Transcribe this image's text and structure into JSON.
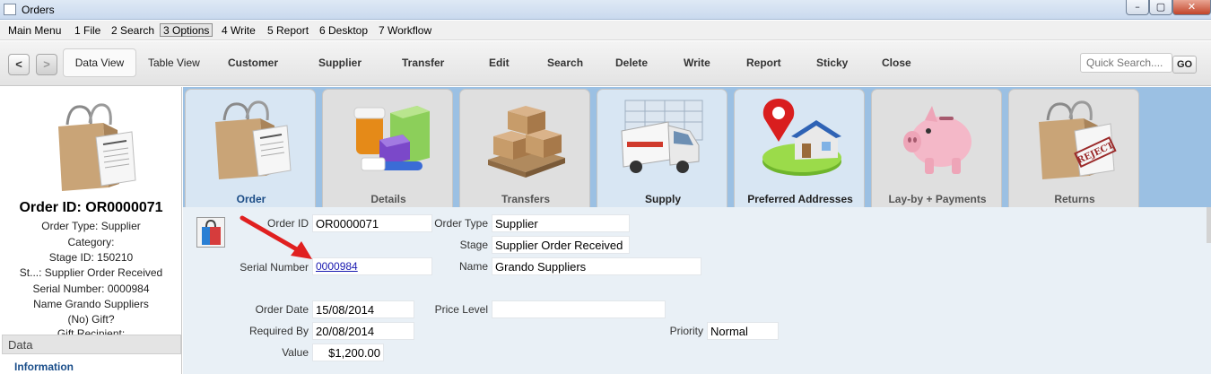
{
  "window": {
    "title": "Orders",
    "min_glyph": "–",
    "max_glyph": "▢",
    "close_glyph": "✕"
  },
  "menu": [
    "Main Menu",
    "1 File",
    "2 Search",
    "3 Options",
    "4 Write",
    "5 Report",
    "6 Desktop",
    "7 Workflow"
  ],
  "toolbar": {
    "back": "<",
    "forward": ">",
    "data_view": "Data View",
    "table_view": "Table View",
    "customer": "Customer",
    "supplier": "Supplier",
    "transfer": "Transfer",
    "edit": "Edit",
    "search": "Search",
    "delete": "Delete",
    "write": "Write",
    "report": "Report",
    "sticky": "Sticky",
    "close": "Close",
    "quick_search_placeholder": "Quick Search....",
    "go": "GO"
  },
  "left": {
    "order_id": "Order ID: OR0000071",
    "lines": [
      "Order Type: Supplier",
      "Category:",
      "Stage ID: 150210",
      "St...: Supplier Order Received",
      "Serial Number: 0000984",
      "Name Grando Suppliers",
      "(No) Gift?",
      "Gift Recipient:"
    ],
    "data_header": "Data",
    "information": "Information"
  },
  "tabs": [
    "Order",
    "Details",
    "Transfers",
    "Supply",
    "Preferred Addresses",
    "Lay-by + Payments",
    "Returns"
  ],
  "form": {
    "order_id_label": "Order ID",
    "order_id": "OR0000071",
    "order_type_label": "Order Type",
    "order_type": "Supplier",
    "stage_label": "Stage",
    "stage": "Supplier Order Received",
    "serial_label": "Serial Number",
    "serial": "0000984",
    "name_label": "Name",
    "name": "Grando Suppliers",
    "order_date_label": "Order Date",
    "order_date": "15/08/2014",
    "price_level_label": "Price Level",
    "price_level": "",
    "required_by_label": "Required By",
    "required_by": "20/08/2014",
    "priority_label": "Priority",
    "priority": "Normal",
    "value_label": "Value",
    "value": "$1,200.00"
  },
  "colors": {
    "tab_strip": "#9bc0e3",
    "content_bg": "#e9f0f6",
    "selected_tab_label": "#1b4c86",
    "arrow": "#e02020"
  }
}
